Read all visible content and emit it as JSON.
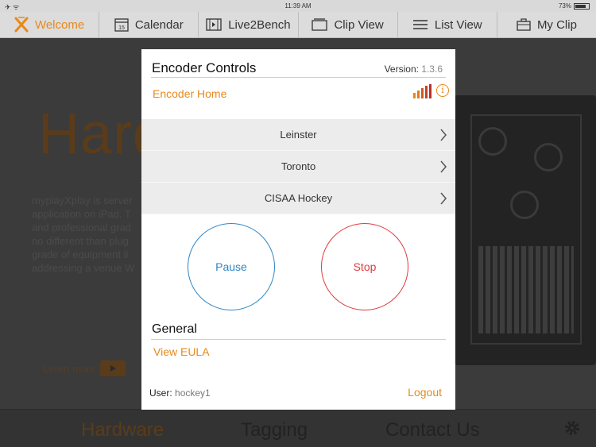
{
  "status_bar": {
    "time": "11:39 AM",
    "battery": "73%",
    "signal_glyphs": "✈ ᯤ"
  },
  "nav": {
    "tabs": [
      {
        "label": "Welcome",
        "icon": "welcome-x-icon",
        "active": true
      },
      {
        "label": "Calendar",
        "icon": "calendar-icon",
        "badge": "15"
      },
      {
        "label": "Live2Bench",
        "icon": "film-icon"
      },
      {
        "label": "Clip View",
        "icon": "clip-view-icon"
      },
      {
        "label": "List View",
        "icon": "list-icon"
      },
      {
        "label": "My Clip",
        "icon": "briefcase-icon"
      }
    ]
  },
  "background": {
    "hero_text": "Hard",
    "body_lines": [
      "myplayXplay is server",
      "application on iPad. T",
      "and professional grad",
      "no different than plug",
      "grade of equipment li",
      "addressing a venue W"
    ],
    "learn_more": "Learn more",
    "bottom_tabs": [
      "Hardware",
      "Tagging",
      "Contact Us"
    ]
  },
  "modal": {
    "title": "Encoder Controls",
    "version_label": "Version:",
    "version_value": "1.3.6",
    "encoder_home": "Encoder Home",
    "encoders": [
      "Leinster",
      "Toronto",
      "CISAA Hockey"
    ],
    "pause_label": "Pause",
    "stop_label": "Stop",
    "general_title": "General",
    "view_eula": "View EULA",
    "user_label": "User:",
    "user_value": "hockey1",
    "logout_label": "Logout"
  },
  "colors": {
    "accent": "#e8891a",
    "pause": "#2f86c6",
    "stop": "#e13b3b",
    "signal_bars": [
      "#e8891a",
      "#e07a18",
      "#d05a22",
      "#c2402a"
    ]
  }
}
